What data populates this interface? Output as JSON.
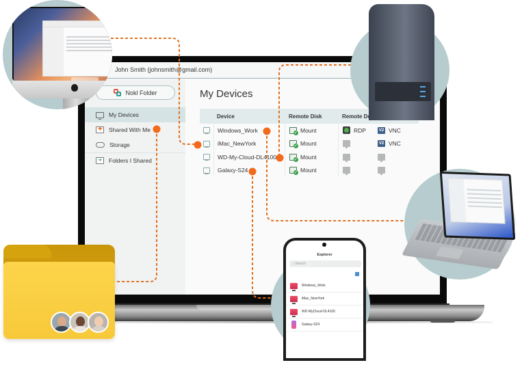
{
  "app": {
    "user_label": "John Smith (johnsmith@gmail.com)",
    "nokl_button_label": "Nokl Folder",
    "main_title": "My Devices"
  },
  "sidebar": {
    "items": [
      {
        "label": "My Devices",
        "icon": "monitor-icon",
        "active": true
      },
      {
        "label": "Shared With Me",
        "icon": "shared-folder-icon",
        "active": false
      },
      {
        "label": "Storage",
        "icon": "cloud-icon",
        "active": false
      },
      {
        "label": "Folders I Shared",
        "icon": "folder-share-icon",
        "active": false
      }
    ]
  },
  "table": {
    "headers": {
      "device": "Device",
      "remote_disk": "Remote Disk",
      "remote_desktop": "Remote Desktop"
    },
    "rows": [
      {
        "device": "Windows_Work",
        "disk": "Mount",
        "rdp": "RDP",
        "vnc": "VNC",
        "rdp_enabled": true,
        "vnc_enabled": true
      },
      {
        "device": "iMac_NewYork",
        "disk": "Mount",
        "rdp": "",
        "vnc": "VNC",
        "rdp_enabled": false,
        "vnc_enabled": true
      },
      {
        "device": "WD-My-Cloud-DL4100",
        "disk": "Mount",
        "rdp": "",
        "vnc": "",
        "rdp_enabled": false,
        "vnc_enabled": false
      },
      {
        "device": "Galaxy-S24",
        "disk": "Mount",
        "rdp": "",
        "vnc": "",
        "rdp_enabled": false,
        "vnc_enabled": false
      }
    ]
  },
  "phone": {
    "title": "Explorer",
    "search_placeholder": "Search",
    "items": [
      {
        "label": "Windows_Work",
        "icon": "monitor-icon"
      },
      {
        "label": "iMac_NewYork",
        "icon": "monitor-icon"
      },
      {
        "label": "WD-MyCloud-DL4100",
        "icon": "monitor-icon"
      },
      {
        "label": "Galaxy-S24",
        "icon": "phone-icon"
      }
    ]
  },
  "vnc_badge": "V2",
  "colors": {
    "accent_orange": "#f26a1b",
    "header_border": "#9bb5b8",
    "active_nav": "#d6e3e4",
    "table_header": "#e1ebec",
    "bubble": "#b6ccce",
    "folder": "#fdd44a"
  }
}
